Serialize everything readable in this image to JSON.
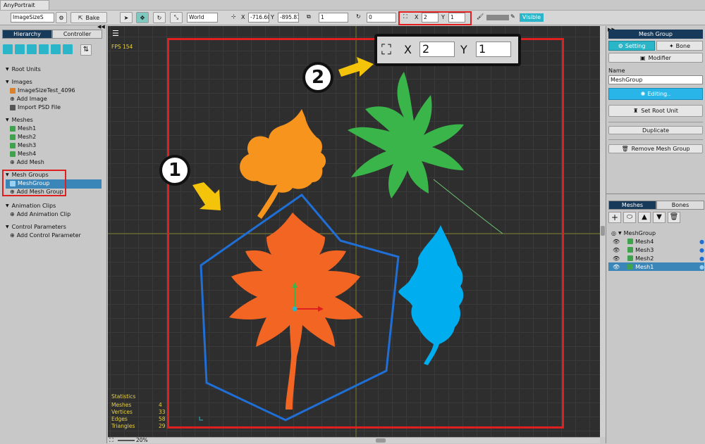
{
  "window": {
    "tab": "AnyPortrait"
  },
  "toolbar": {
    "image_name": "ImageSizeS",
    "bake": "Bake",
    "space": "World",
    "pos_x_label": "X",
    "pos_x": "-716.60",
    "pos_y_label": "Y",
    "pos_y": "-895.81",
    "rotation_scale_value": "1",
    "rotation": "0",
    "scale_x_label": "X",
    "scale_x": "2",
    "scale_y_label": "Y",
    "scale_y": "1",
    "visible": "Visible"
  },
  "left_panel": {
    "tabs": [
      "Hierarchy",
      "Controller"
    ],
    "sections": {
      "root_units": "Root Units",
      "images": "Images",
      "image_item": "ImageSizeTest_4096",
      "add_image": "Add Image",
      "import_psd": "Import PSD File",
      "meshes": "Meshes",
      "mesh_items": [
        "Mesh1",
        "Mesh2",
        "Mesh3",
        "Mesh4"
      ],
      "add_mesh": "Add Mesh",
      "mesh_groups": "Mesh Groups",
      "mesh_group_item": "MeshGroup",
      "add_mesh_group": "Add Mesh Group",
      "animation_clips": "Animation Clips",
      "add_animation_clip": "Add Animation Clip",
      "control_parameters": "Control Parameters",
      "add_control_parameter": "Add Control Parameter"
    }
  },
  "viewport": {
    "fps": "FPS 154",
    "callout_1": "1",
    "callout_2": "2",
    "zoom_label_x": "X",
    "zoom_label_y": "Y",
    "zoom_x": "2",
    "zoom_y": "1",
    "statistics": {
      "title": "Statistics",
      "rows": [
        {
          "label": "Meshes",
          "value": "4"
        },
        {
          "label": "Vertices",
          "value": "33"
        },
        {
          "label": "Edges",
          "value": "58"
        },
        {
          "label": "Triangles",
          "value": "29"
        }
      ]
    },
    "zoom_percent": "20%"
  },
  "right_panel": {
    "title": "Mesh Group",
    "tab_setting": "Setting",
    "tab_bone": "Bone",
    "modifier": "Modifier",
    "name_label": "Name",
    "name_value": "MeshGroup",
    "editing": "Editing..",
    "set_root_unit": "Set Root Unit",
    "duplicate": "Duplicate",
    "remove": "Remove Mesh Group",
    "tabs2": [
      "Meshes",
      "Bones"
    ],
    "layers": [
      "MeshGroup",
      "Mesh4",
      "Mesh3",
      "Mesh2",
      "Mesh1"
    ]
  },
  "colors": {
    "accent": "#2ab5c8",
    "highlight_red": "#e02020",
    "leaf_orange": "#f26522",
    "leaf_light_orange": "#f7941d",
    "leaf_green": "#39b54a",
    "leaf_blue": "#00aeef"
  }
}
